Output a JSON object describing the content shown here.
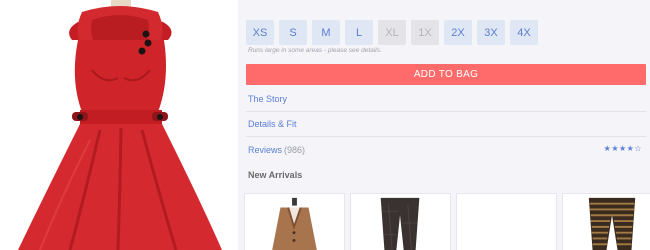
{
  "product": {
    "image_icon": "red-dress-icon"
  },
  "sizes": [
    {
      "label": "XS",
      "available": true
    },
    {
      "label": "S",
      "available": true
    },
    {
      "label": "M",
      "available": true
    },
    {
      "label": "L",
      "available": true
    },
    {
      "label": "XL",
      "available": false
    },
    {
      "label": "1X",
      "available": false
    },
    {
      "label": "2X",
      "available": true
    },
    {
      "label": "3X",
      "available": true
    },
    {
      "label": "4X",
      "available": true
    }
  ],
  "size_note": "Runs large in some areas - please see details.",
  "add_to_bag": "ADD TO BAG",
  "sections": {
    "story": "The Story",
    "details": "Details & Fit",
    "reviews": "Reviews",
    "reviews_count": "(986)",
    "reviews_stars": "★★★★☆"
  },
  "new_arrivals": {
    "title": "New Arrivals",
    "items": [
      {
        "icon": "cardigan-icon"
      },
      {
        "icon": "tights-icon"
      },
      {
        "icon": "blank-thumbnail-icon"
      },
      {
        "icon": "striped-tights-icon"
      }
    ]
  },
  "colors": {
    "accent": "#5b7fd6",
    "button": "#ff6b6b",
    "dress": "#d9262c"
  }
}
